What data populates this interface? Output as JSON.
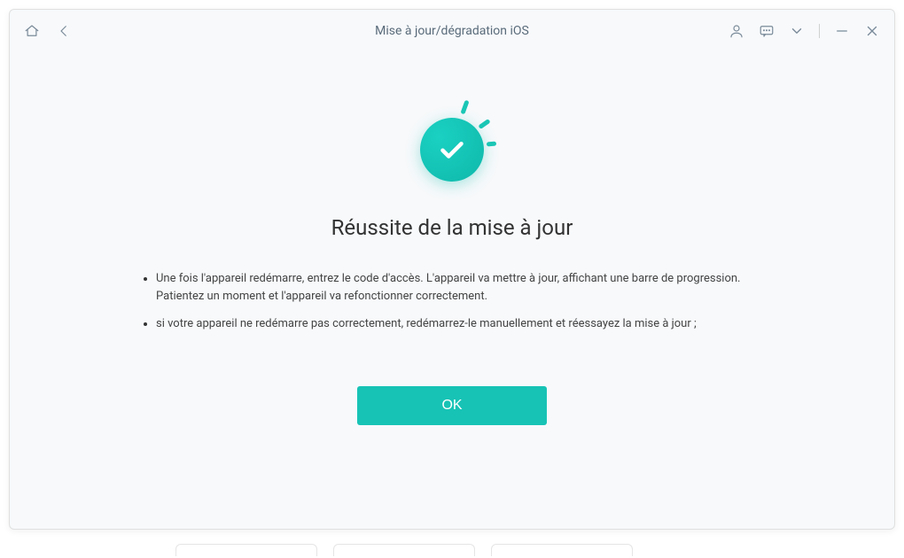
{
  "window": {
    "title": "Mise à jour/dégradation iOS"
  },
  "success": {
    "headline": "Réussite de la mise à jour",
    "bullets": [
      "Une fois l'appareil redémarre, entrez le code d'accès. L'appareil va mettre à jour, affichant une barre de progression. Patientez un moment et l'appareil va refonctionner correctement.",
      "si votre appareil ne redémarre pas correctement, redémarrez-le manuellement et réessayez la mise à jour ;"
    ],
    "ok_label": "OK"
  },
  "icons": {
    "home": "home-icon",
    "back": "back-icon",
    "user": "user-icon",
    "feedback": "feedback-icon",
    "dropdown": "chevron-down-icon",
    "minimize": "minimize-icon",
    "close": "close-icon",
    "check": "check-icon"
  }
}
